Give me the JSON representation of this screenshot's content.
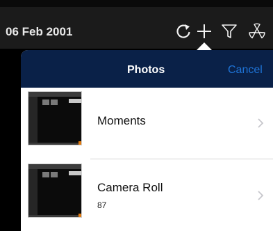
{
  "topbar": {
    "date": "06 Feb 2001",
    "icons": [
      "refresh-icon",
      "add-icon",
      "filter-icon",
      "radiation-icon"
    ]
  },
  "popover": {
    "title": "Photos",
    "cancel_label": "Cancel",
    "albums": [
      {
        "name": "Moments",
        "count": ""
      },
      {
        "name": "Camera Roll",
        "count": "87"
      }
    ]
  },
  "colors": {
    "topbar_bg": "#1b1b1b",
    "header_bg": "#0a2148",
    "cancel_blue": "#1e73d6",
    "row_bg": "#ffffff"
  }
}
